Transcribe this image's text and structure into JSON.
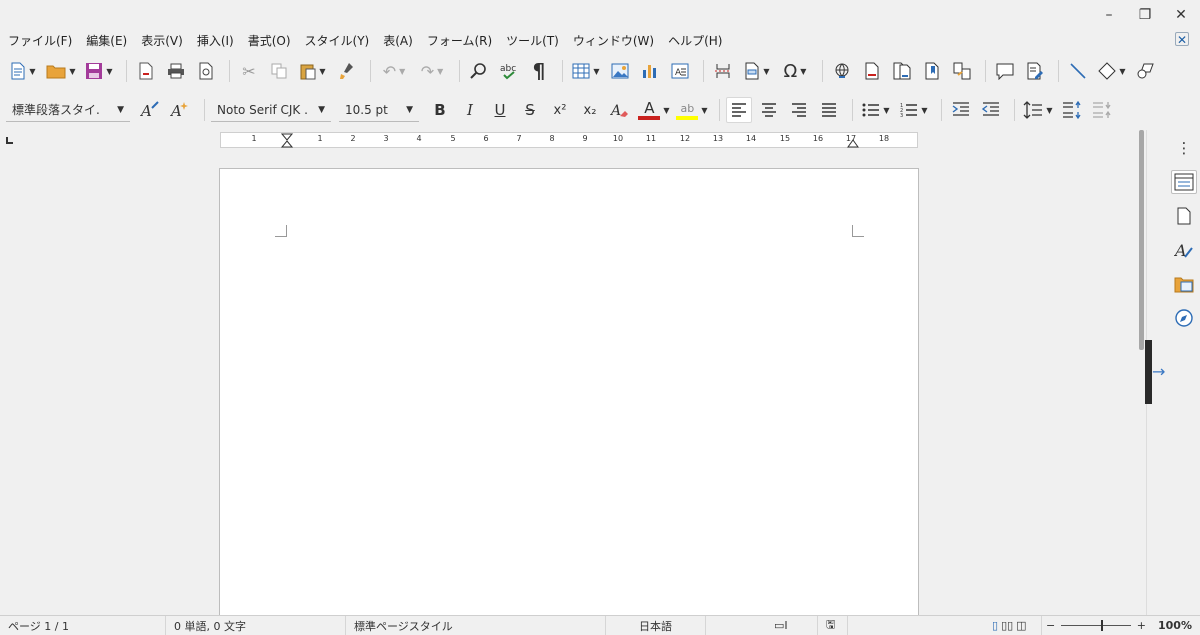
{
  "window": {
    "minimize": "–",
    "restore": "❐",
    "close": "✕"
  },
  "menu": {
    "items": [
      "ファイル(F)",
      "編集(E)",
      "表示(V)",
      "挿入(I)",
      "書式(O)",
      "スタイル(Y)",
      "表(A)",
      "フォーム(R)",
      "ツール(T)",
      "ウィンドウ(W)",
      "ヘルプ(H)"
    ],
    "close_doc": "✕"
  },
  "toolbar2": {
    "paragraph_style": "標準段落スタイ.",
    "font_name": "Noto Serif CJK .",
    "font_size": "10.5 pt",
    "bold": "B",
    "italic": "I",
    "underline": "U",
    "strike": "S",
    "superscript": "x²",
    "subscript": "x₂",
    "font_color_letter": "A",
    "highlight_letter": "ab"
  },
  "ruler": {
    "ticks": [
      "1",
      "1",
      "2",
      "3",
      "4",
      "5",
      "6",
      "7",
      "8",
      "9",
      "10",
      "11",
      "12",
      "13",
      "14",
      "15",
      "16",
      "17",
      "18"
    ]
  },
  "status": {
    "page": "ページ 1 / 1",
    "words": "0 単語, 0 文字",
    "page_style": "標準ページスタイル",
    "language": "日本語",
    "zoom": "100%",
    "zoom_out": "−",
    "zoom_in": "+"
  },
  "colors": {
    "font_color": "#c9211e",
    "highlight": "#ffff00",
    "accent": "#3a78c3"
  }
}
